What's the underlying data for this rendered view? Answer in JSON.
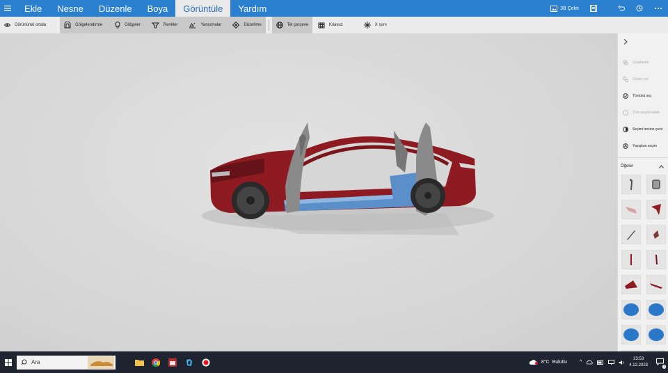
{
  "menu": {
    "items": [
      {
        "label": "Ekle"
      },
      {
        "label": "Nesne"
      },
      {
        "label": "Düzenle"
      },
      {
        "label": "Boya"
      },
      {
        "label": "Görüntüle"
      },
      {
        "label": "Yardım"
      }
    ],
    "active_index": 4,
    "library_label": "3B Çektı"
  },
  "toolbar": {
    "center_view": "Görünümü ortala",
    "shading": "Gölgelendirme",
    "shadows": "Gölgeler",
    "colors": "Renkler",
    "reflections": "Yansımalar",
    "smoothing": "Düzeltme",
    "wireframe": "Tel çerçeve",
    "grid": "Kılavuz",
    "xray": "X ışını"
  },
  "right_panel": {
    "actions": [
      {
        "label": "Gruplandır",
        "disabled": true
      },
      {
        "label": "Grubu çöz",
        "disabled": true
      },
      {
        "label": "Tümünü seç",
        "disabled": false
      },
      {
        "label": "Tüm seçimi kaldır",
        "disabled": true
      },
      {
        "label": "Seçimi tersine çevir",
        "disabled": false
      },
      {
        "label": "Yapışkan seçim",
        "disabled": false
      }
    ],
    "items_header": "Öğeler"
  },
  "taskbar": {
    "search_placeholder": "Ara",
    "weather_temp": "8°C",
    "weather_text": "Bulutlu",
    "time": "23:53",
    "date": "4.12.2023",
    "notification_count": "1"
  },
  "colors": {
    "menubar": "#2b7fcf",
    "car_body": "#8e1b22",
    "floor": "#5a8fc9"
  }
}
